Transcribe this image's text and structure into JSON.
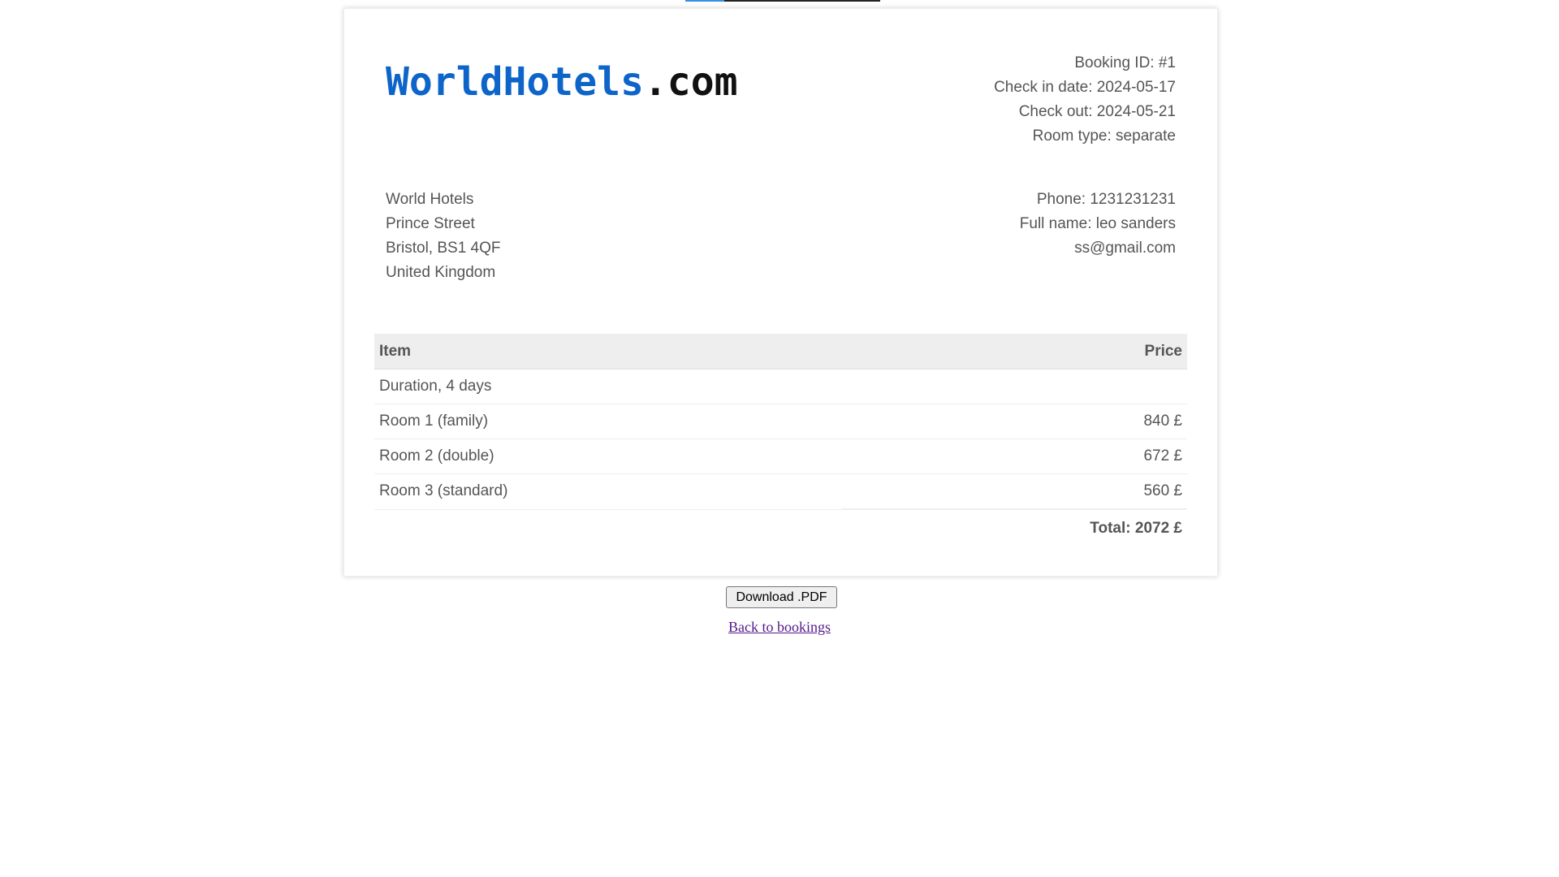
{
  "logo": {
    "brand": "WorldHotels",
    "tld": ".com",
    "brand_color": "#0d64c9"
  },
  "booking": {
    "id": "Booking ID: #1",
    "check_in": "Check in date: 2024-05-17",
    "check_out": "Check out: 2024-05-21",
    "room_type": "Room type: separate"
  },
  "hotel_address": {
    "name": "World Hotels",
    "street": "Prince Street",
    "city": "Bristol, BS1 4QF",
    "country": "United Kingdom"
  },
  "customer": {
    "phone": "Phone: 1231231231",
    "full_name": "Full name: leo sanders",
    "email": "ss@gmail.com"
  },
  "table": {
    "header_item": "Item",
    "header_price": "Price",
    "rows": [
      {
        "item": "Duration, 4 days",
        "price": ""
      },
      {
        "item": "Room 1 (family)",
        "price": "840 £"
      },
      {
        "item": "Room 2 (double)",
        "price": "672 £"
      },
      {
        "item": "Room 3 (standard)",
        "price": "560 £"
      }
    ],
    "total": "Total: 2072 £"
  },
  "actions": {
    "download_label": "Download .PDF",
    "back_label": "Back to bookings"
  }
}
